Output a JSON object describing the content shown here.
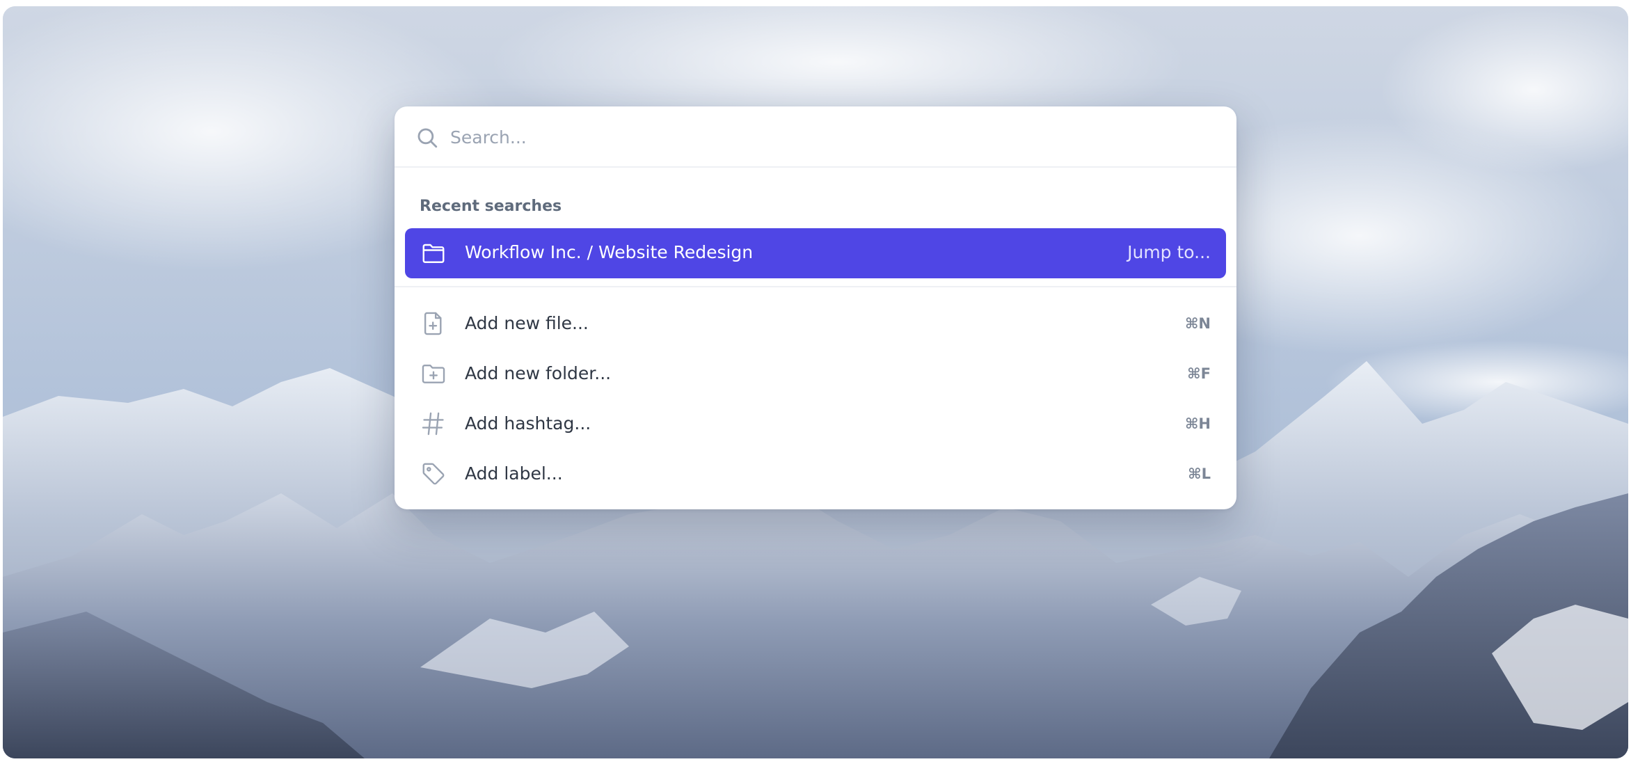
{
  "search": {
    "placeholder": "Search...",
    "value": ""
  },
  "recent": {
    "heading": "Recent searches",
    "items": [
      {
        "label": "Workflow Inc. / Website Redesign",
        "hint": "Jump to...",
        "icon": "folder-icon"
      }
    ]
  },
  "actions": [
    {
      "label": "Add new file...",
      "shortcut": "⌘N",
      "icon": "file-plus-icon"
    },
    {
      "label": "Add new folder...",
      "shortcut": "⌘F",
      "icon": "folder-plus-icon"
    },
    {
      "label": "Add hashtag...",
      "shortcut": "⌘H",
      "icon": "hashtag-icon"
    },
    {
      "label": "Add label...",
      "shortcut": "⌘L",
      "icon": "tag-icon"
    }
  ],
  "colors": {
    "accent": "#4f46e5",
    "icon": "#9aa3b2"
  }
}
